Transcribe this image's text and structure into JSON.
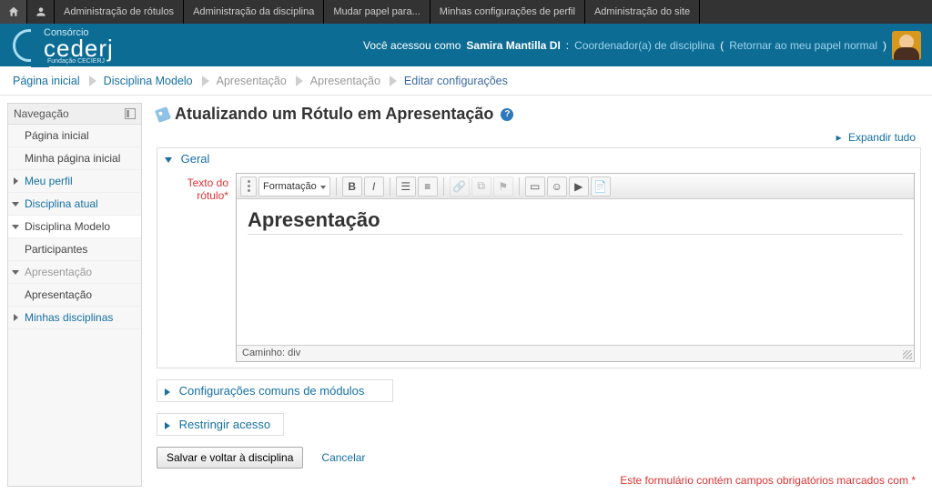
{
  "topbar": {
    "items": [
      "Administração de rótulos",
      "Administração da disciplina",
      "Mudar papel para...",
      "Minhas configurações de perfil",
      "Administração do site"
    ]
  },
  "header": {
    "logo_top": "Consórcio",
    "logo_main": "cederj",
    "logo_sub": "Fundação CECIERJ",
    "login_pre": "Você acessou como ",
    "user": "Samira Mantilla DI",
    "role_sep": ": ",
    "role": "Coordenador(a) de disciplina",
    "return_open": " (",
    "return_link": "Retornar ao meu papel normal",
    "return_close": ")"
  },
  "breadcrumb": [
    "Página inicial",
    "Disciplina Modelo",
    "Apresentação",
    "Apresentação",
    "Editar configurações"
  ],
  "navblock": {
    "title": "Navegação",
    "items": [
      {
        "label": "Página inicial"
      },
      {
        "label": "Minha página inicial"
      },
      {
        "label": "Meu perfil"
      },
      {
        "label": "Disciplina atual"
      },
      {
        "label": "Disciplina Modelo"
      },
      {
        "label": "Participantes"
      },
      {
        "label": "Apresentação"
      },
      {
        "label": "Apresentação"
      },
      {
        "label": "Minhas disciplinas"
      }
    ]
  },
  "page": {
    "title": "Atualizando um Rótulo em Apresentação",
    "expand_all": "Expandir tudo",
    "fieldsets": {
      "geral": "Geral",
      "comuns": "Configurações comuns de módulos",
      "restringir": "Restringir acesso"
    },
    "field_label_l1": "Texto do",
    "field_label_l2": "rótulo",
    "field_required_mark": "*",
    "editor": {
      "format_label": "Formatação",
      "content_heading": "Apresentação",
      "path_prefix": "Caminho: ",
      "path_value": "div"
    },
    "save_btn": "Salvar e voltar à disciplina",
    "cancel_btn": "Cancelar",
    "required_note": "Este formulário contém campos obrigatórios marcados com ",
    "required_star": "*"
  }
}
